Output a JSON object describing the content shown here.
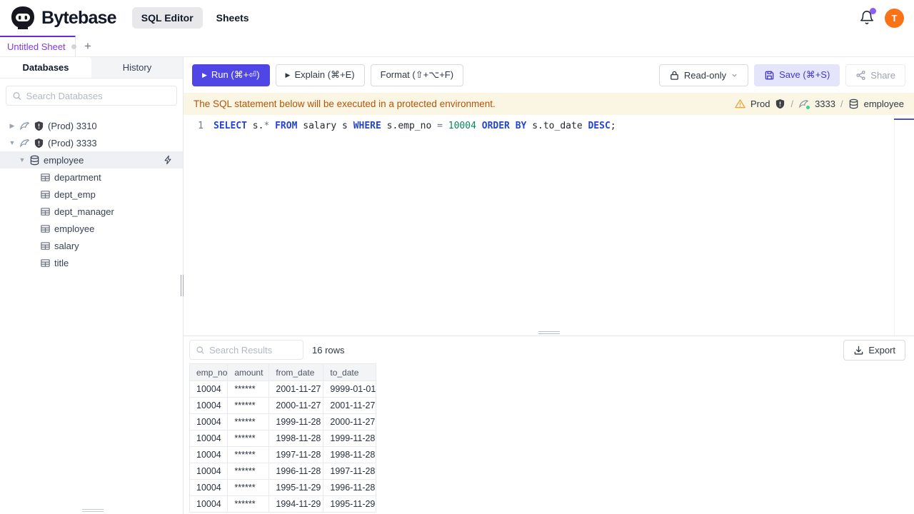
{
  "header": {
    "brand": "Bytebase",
    "nav_sql_editor": "SQL Editor",
    "nav_sheets": "Sheets",
    "avatar_initial": "T"
  },
  "tabs": {
    "active_tab": "Untitled Sheet",
    "add_tab": "+"
  },
  "sidebar": {
    "tab_databases": "Databases",
    "tab_history": "History",
    "search_placeholder": "Search Databases",
    "instances": [
      {
        "label": "(Prod) 3310",
        "expanded": false
      },
      {
        "label": "(Prod) 3333",
        "expanded": true
      }
    ],
    "database": "employee",
    "tables": [
      "department",
      "dept_emp",
      "dept_manager",
      "employee",
      "salary",
      "title"
    ]
  },
  "toolbar": {
    "run_label": "Run (⌘+⏎)",
    "explain_label": "Explain (⌘+E)",
    "format_label": "Format (⇧+⌥+F)",
    "readonly_label": "Read-only",
    "save_label": "Save (⌘+S)",
    "share_label": "Share"
  },
  "banner": {
    "message": "The SQL statement below will be executed in a protected environment.",
    "environment": "Prod",
    "separator": "/",
    "instance": "3333",
    "database": "employee"
  },
  "editor": {
    "line_number": "1",
    "sql_text": "SELECT s.* FROM salary s WHERE s.emp_no = 10004 ORDER BY s.to_date DESC;",
    "tokens": [
      {
        "text": "SELECT",
        "type": "kw"
      },
      {
        "text": " s.",
        "type": "pl"
      },
      {
        "text": "*",
        "type": "op"
      },
      {
        "text": " ",
        "type": "pl"
      },
      {
        "text": "FROM",
        "type": "kw"
      },
      {
        "text": " salary s ",
        "type": "pl"
      },
      {
        "text": "WHERE",
        "type": "kw"
      },
      {
        "text": " s.emp_no ",
        "type": "pl"
      },
      {
        "text": "=",
        "type": "op"
      },
      {
        "text": " ",
        "type": "pl"
      },
      {
        "text": "10004",
        "type": "num"
      },
      {
        "text": " ",
        "type": "pl"
      },
      {
        "text": "ORDER",
        "type": "kw"
      },
      {
        "text": " ",
        "type": "pl"
      },
      {
        "text": "BY",
        "type": "kw"
      },
      {
        "text": " s.to_date ",
        "type": "pl"
      },
      {
        "text": "DESC",
        "type": "kw"
      },
      {
        "text": ";",
        "type": "pl"
      }
    ]
  },
  "results": {
    "search_placeholder": "Search Results",
    "row_count": "16 rows",
    "export_label": "Export",
    "columns": [
      "emp_no",
      "amount",
      "from_date",
      "to_date"
    ],
    "rows": [
      [
        "10004",
        "******",
        "2001-11-27",
        "9999-01-01"
      ],
      [
        "10004",
        "******",
        "2000-11-27",
        "2001-11-27"
      ],
      [
        "10004",
        "******",
        "1999-11-28",
        "2000-11-27"
      ],
      [
        "10004",
        "******",
        "1998-11-28",
        "1999-11-28"
      ],
      [
        "10004",
        "******",
        "1997-11-28",
        "1998-11-28"
      ],
      [
        "10004",
        "******",
        "1996-11-28",
        "1997-11-28"
      ],
      [
        "10004",
        "******",
        "1995-11-29",
        "1996-11-28"
      ],
      [
        "10004",
        "******",
        "1994-11-29",
        "1995-11-29"
      ]
    ]
  },
  "colors": {
    "accent_indigo": "#4f46e5",
    "tab_purple": "#7c3aed",
    "banner_bg": "#fbf6e3",
    "banner_text": "#b45309",
    "avatar_orange": "#f97316",
    "keyword_blue": "#2544d0",
    "number_green": "#098658"
  }
}
